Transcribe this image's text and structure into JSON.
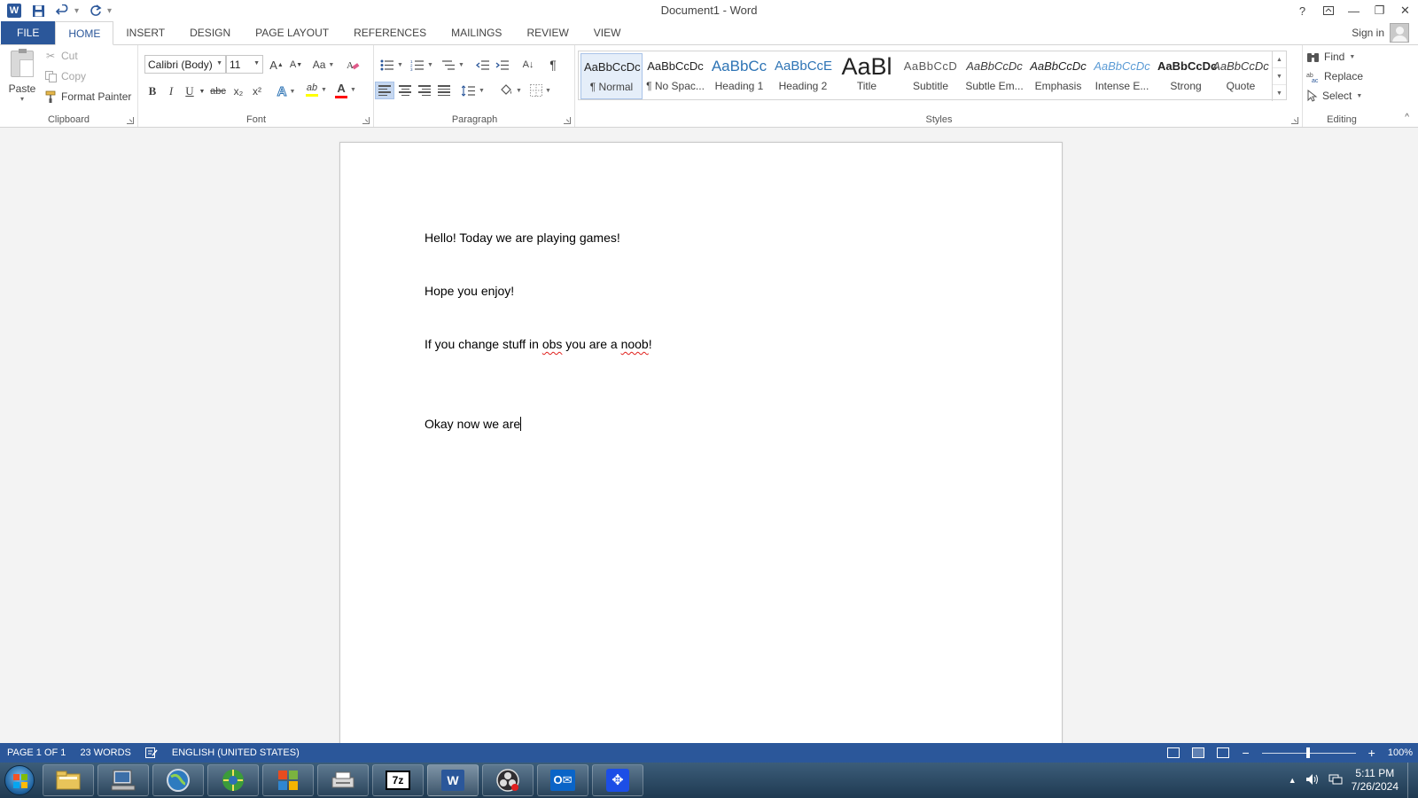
{
  "window": {
    "title": "Document1 - Word",
    "help": "?",
    "options": "⊞",
    "minimize": "—",
    "restore": "❐",
    "close": "✕"
  },
  "qat": {
    "app_icon": "W",
    "save_icon": "save-icon",
    "undo_icon": "undo-icon",
    "redo_icon": "redo-icon",
    "customize": "▾"
  },
  "tabs": [
    {
      "label": "FILE"
    },
    {
      "label": "HOME"
    },
    {
      "label": "INSERT"
    },
    {
      "label": "DESIGN"
    },
    {
      "label": "PAGE LAYOUT"
    },
    {
      "label": "REFERENCES"
    },
    {
      "label": "MAILINGS"
    },
    {
      "label": "REVIEW"
    },
    {
      "label": "VIEW"
    }
  ],
  "account": {
    "signin": "Sign in"
  },
  "ribbon": {
    "clipboard": {
      "label": "Clipboard",
      "paste": "Paste",
      "cut": "Cut",
      "copy": "Copy",
      "format_painter": "Format Painter"
    },
    "font": {
      "label": "Font",
      "font_name": "Calibri (Body)",
      "font_size": "11",
      "grow": "A",
      "shrink": "A",
      "change_case": "Aa",
      "bold": "B",
      "italic": "I",
      "underline": "U",
      "strike": "abc",
      "subscript": "x₂",
      "superscript": "x²",
      "text_effects": "A",
      "highlight": "ab",
      "font_color": "A",
      "highlight_color": "#ffff00",
      "font_color_value": "#ff0000"
    },
    "paragraph": {
      "label": "Paragraph",
      "sort": "A↓",
      "show_marks": "¶"
    },
    "styles": {
      "label": "Styles",
      "items": [
        {
          "sample": "AaBbCcDc",
          "name": "¶ Normal",
          "color": "#222222"
        },
        {
          "sample": "AaBbCcDc",
          "name": "¶ No Spac...",
          "color": "#222222"
        },
        {
          "sample": "AaBbCc",
          "name": "Heading 1",
          "color": "#2e74b5"
        },
        {
          "sample": "AaBbCcE",
          "name": "Heading 2",
          "color": "#2e74b5"
        },
        {
          "sample": "AaBl",
          "name": "Title",
          "color": "#111111"
        },
        {
          "sample": "AaBbCcD",
          "name": "Subtitle",
          "color": "#5a5a5a"
        },
        {
          "sample": "AaBbCcDc",
          "name": "Subtle Em...",
          "color": "#404040"
        },
        {
          "sample": "AaBbCcDc",
          "name": "Emphasis",
          "color": "#222222"
        },
        {
          "sample": "AaBbCcDc",
          "name": "Intense E...",
          "color": "#5b9bd5"
        },
        {
          "sample": "AaBbCcDc",
          "name": "Strong",
          "color": "#111111"
        },
        {
          "sample": "AaBbCcDc",
          "name": "Quote",
          "color": "#404040"
        }
      ]
    },
    "editing": {
      "label": "Editing",
      "find": "Find",
      "replace": "Replace",
      "select": "Select"
    }
  },
  "document": {
    "paragraphs": [
      {
        "text": "Hello! Today we are playing games!"
      },
      {
        "text": "Hope you enjoy!"
      },
      {
        "pre": "If you change stuff in ",
        "w1": "obs",
        "mid": " you are a ",
        "w2": "noob",
        "post": "!"
      },
      {
        "text": "Okay now we are"
      }
    ]
  },
  "statusbar": {
    "page": "PAGE 1 OF 1",
    "words": "23 WORDS",
    "language": "ENGLISH (UNITED STATES)",
    "zoom_minus": "−",
    "zoom_plus": "+",
    "zoom": "100%"
  },
  "taskbar": {
    "apps": [
      {
        "name": "explorer-icon",
        "label": "📁"
      },
      {
        "name": "computer-icon",
        "label": "🖥"
      },
      {
        "name": "globe-icon",
        "label": "🌐"
      },
      {
        "name": "browser-icon",
        "label": "🌍"
      },
      {
        "name": "office-icon",
        "label": "▦"
      },
      {
        "name": "scanner-icon",
        "label": "🖨"
      },
      {
        "name": "7zip-icon",
        "label": "7z"
      },
      {
        "name": "word-icon",
        "label": "W"
      },
      {
        "name": "obs-icon",
        "label": "◉"
      },
      {
        "name": "outlook-icon",
        "label": "O✉"
      },
      {
        "name": "app-icon",
        "label": "✥"
      }
    ],
    "time": "5:11 PM",
    "date": "7/26/2024"
  },
  "colors": {
    "accent": "#2b579a",
    "spell_error": "#e0201c"
  }
}
